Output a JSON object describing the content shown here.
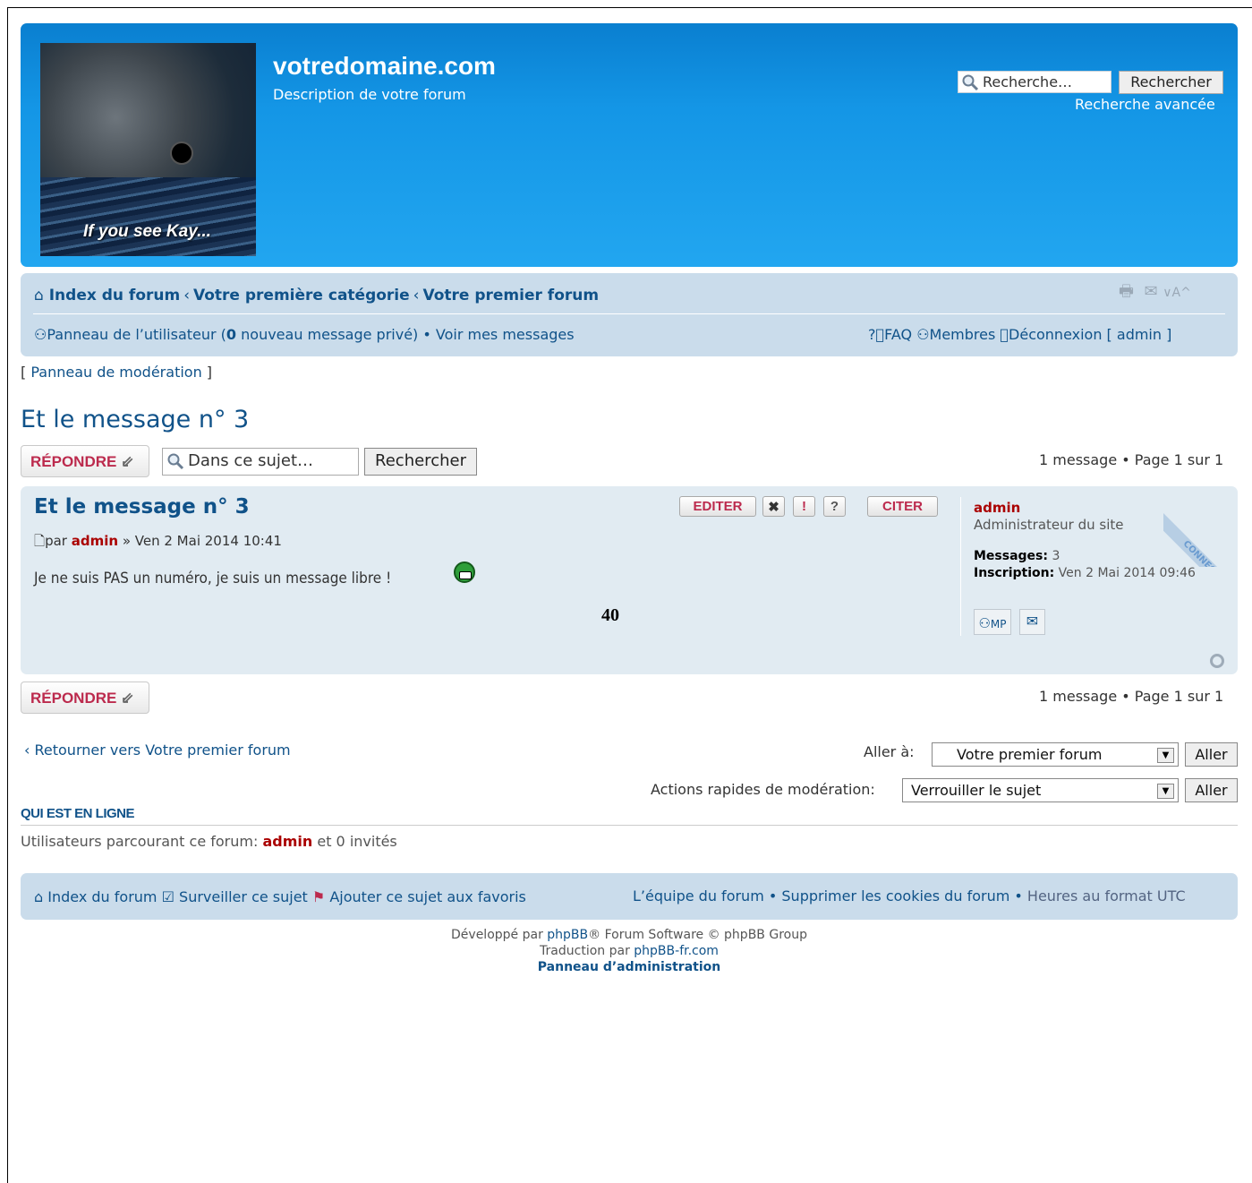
{
  "header": {
    "site_title": "votredomaine.com",
    "site_description": "Description de votre forum",
    "logo_caption": "If you see Kay...",
    "search_placeholder": "Recherche…",
    "search_button": "Rechercher",
    "advanced_search": "Recherche avancée"
  },
  "navbar": {
    "breadcrumbs": [
      "Index du forum",
      "Votre première catégorie",
      "Votre premier forum"
    ],
    "ucp_label": "Panneau de l’utilisateur (",
    "pm_count": "0",
    "pm_suffix": " nouveau message privé)",
    "view_posts": "Voir mes messages",
    "faq": "FAQ",
    "members": "Membres",
    "logout": "Déconnexion [ admin ]"
  },
  "mcp_link": "Panneau de modération",
  "topic": {
    "title": "Et le message n° 3",
    "reply_button": "RÉPONDRE",
    "search_placeholder": "Dans ce sujet…",
    "search_button": "Rechercher",
    "pagination": "1 message • Page 1 sur 1"
  },
  "post": {
    "title": "Et le message n° 3",
    "by": "par",
    "author": "admin",
    "date": "» Ven 2 Mai 2014 10:41",
    "body": "Je ne suis PAS un numéro, je suis un message libre !",
    "extra_number": "40",
    "buttons": {
      "edit": "EDITER",
      "quote": "CITER"
    },
    "online_badge": "CONNECTE"
  },
  "profile": {
    "name": "admin",
    "rank": "Administrateur du site",
    "posts_label": "Messages:",
    "posts_value": "3",
    "joined_label": "Inscription:",
    "joined_value": "Ven 2 Mai 2014 09:46",
    "pm_button": "MP"
  },
  "jump": {
    "return_link": "Retourner vers Votre premier forum",
    "label": "Aller à:",
    "selected": "Votre premier forum",
    "button": "Aller"
  },
  "moderation": {
    "label": "Actions rapides de modération:",
    "selected": "Verrouiller le sujet",
    "button": "Aller"
  },
  "online": {
    "heading": "QUI EST EN LIGNE",
    "prefix": "Utilisateurs parcourant ce forum:",
    "user": "admin",
    "suffix": "et 0 invités"
  },
  "footer": {
    "index": "Index du forum",
    "watch": "Surveiller ce sujet",
    "bookmark": "Ajouter ce sujet aux favoris",
    "team": "L’équipe du forum",
    "cookies": "Supprimer les cookies du forum",
    "timezone": "Heures au format UTC",
    "powered_prefix": "Développé par",
    "powered_link": "phpBB",
    "powered_suffix": "® Forum Software © phpBB Group",
    "translation_prefix": "Traduction par",
    "translation_link": "phpBB-fr.com",
    "acp": "Panneau d’administration"
  },
  "colors": {
    "header_blue": "#1496e6",
    "nav_bg": "#cadceb",
    "post_bg": "#e1ebf2",
    "link": "#105289",
    "author_red": "#aa0000",
    "reply_red": "#bc2a4d"
  }
}
